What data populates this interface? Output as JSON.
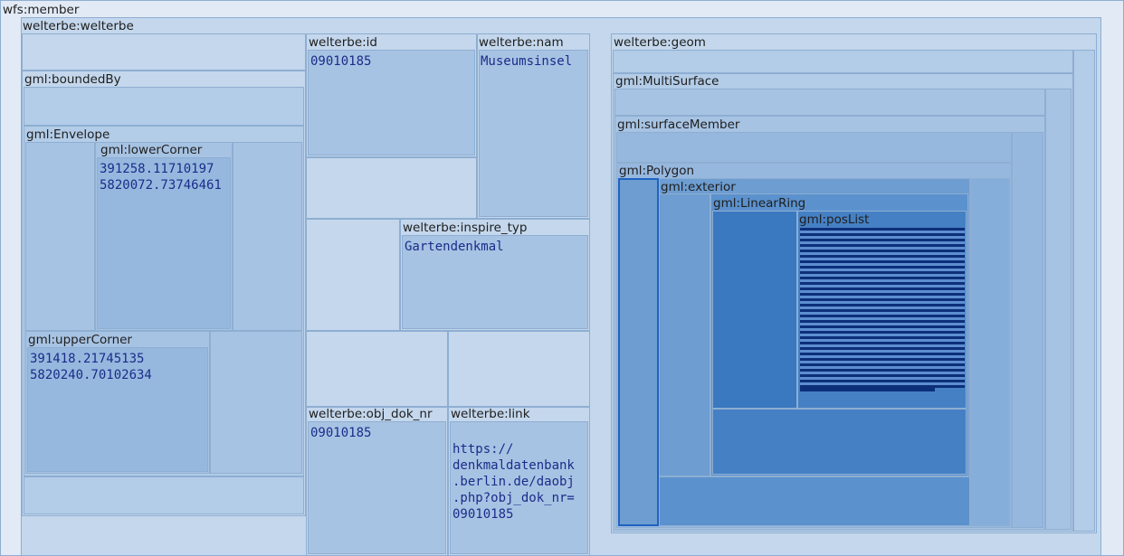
{
  "member": {
    "label": "wfs:member"
  },
  "welterbe": {
    "label": "welterbe:welterbe"
  },
  "boundedBy": {
    "label": "gml:boundedBy"
  },
  "envelope": {
    "label": "gml:Envelope"
  },
  "lowerCorner": {
    "label": "gml:lowerCorner",
    "value": "391258.11710197\n5820072.73746461"
  },
  "upperCorner": {
    "label": "gml:upperCorner",
    "value": "391418.21745135\n5820240.70102634"
  },
  "id": {
    "label": "welterbe:id",
    "value": "09010185"
  },
  "nam": {
    "label": "welterbe:nam",
    "value": "Museumsinsel"
  },
  "inspire_typ": {
    "label": "welterbe:inspire_typ",
    "value": "Gartendenkmal"
  },
  "obj_dok_nr": {
    "label": "welterbe:obj_dok_nr",
    "value": "09010185"
  },
  "link": {
    "label": "welterbe:link",
    "value": "https://\ndenkmaldatenbank\n.berlin.de/daobj\n.php?obj_dok_nr=\n09010185"
  },
  "geom": {
    "label": "welterbe:geom"
  },
  "multiSurface": {
    "label": "gml:MultiSurface"
  },
  "surfaceMember": {
    "label": "gml:surfaceMember"
  },
  "polygon": {
    "label": "gml:Polygon"
  },
  "exterior": {
    "label": "gml:exterior"
  },
  "linearRing": {
    "label": "gml:LinearRing"
  },
  "posList": {
    "label": "gml:posList"
  }
}
